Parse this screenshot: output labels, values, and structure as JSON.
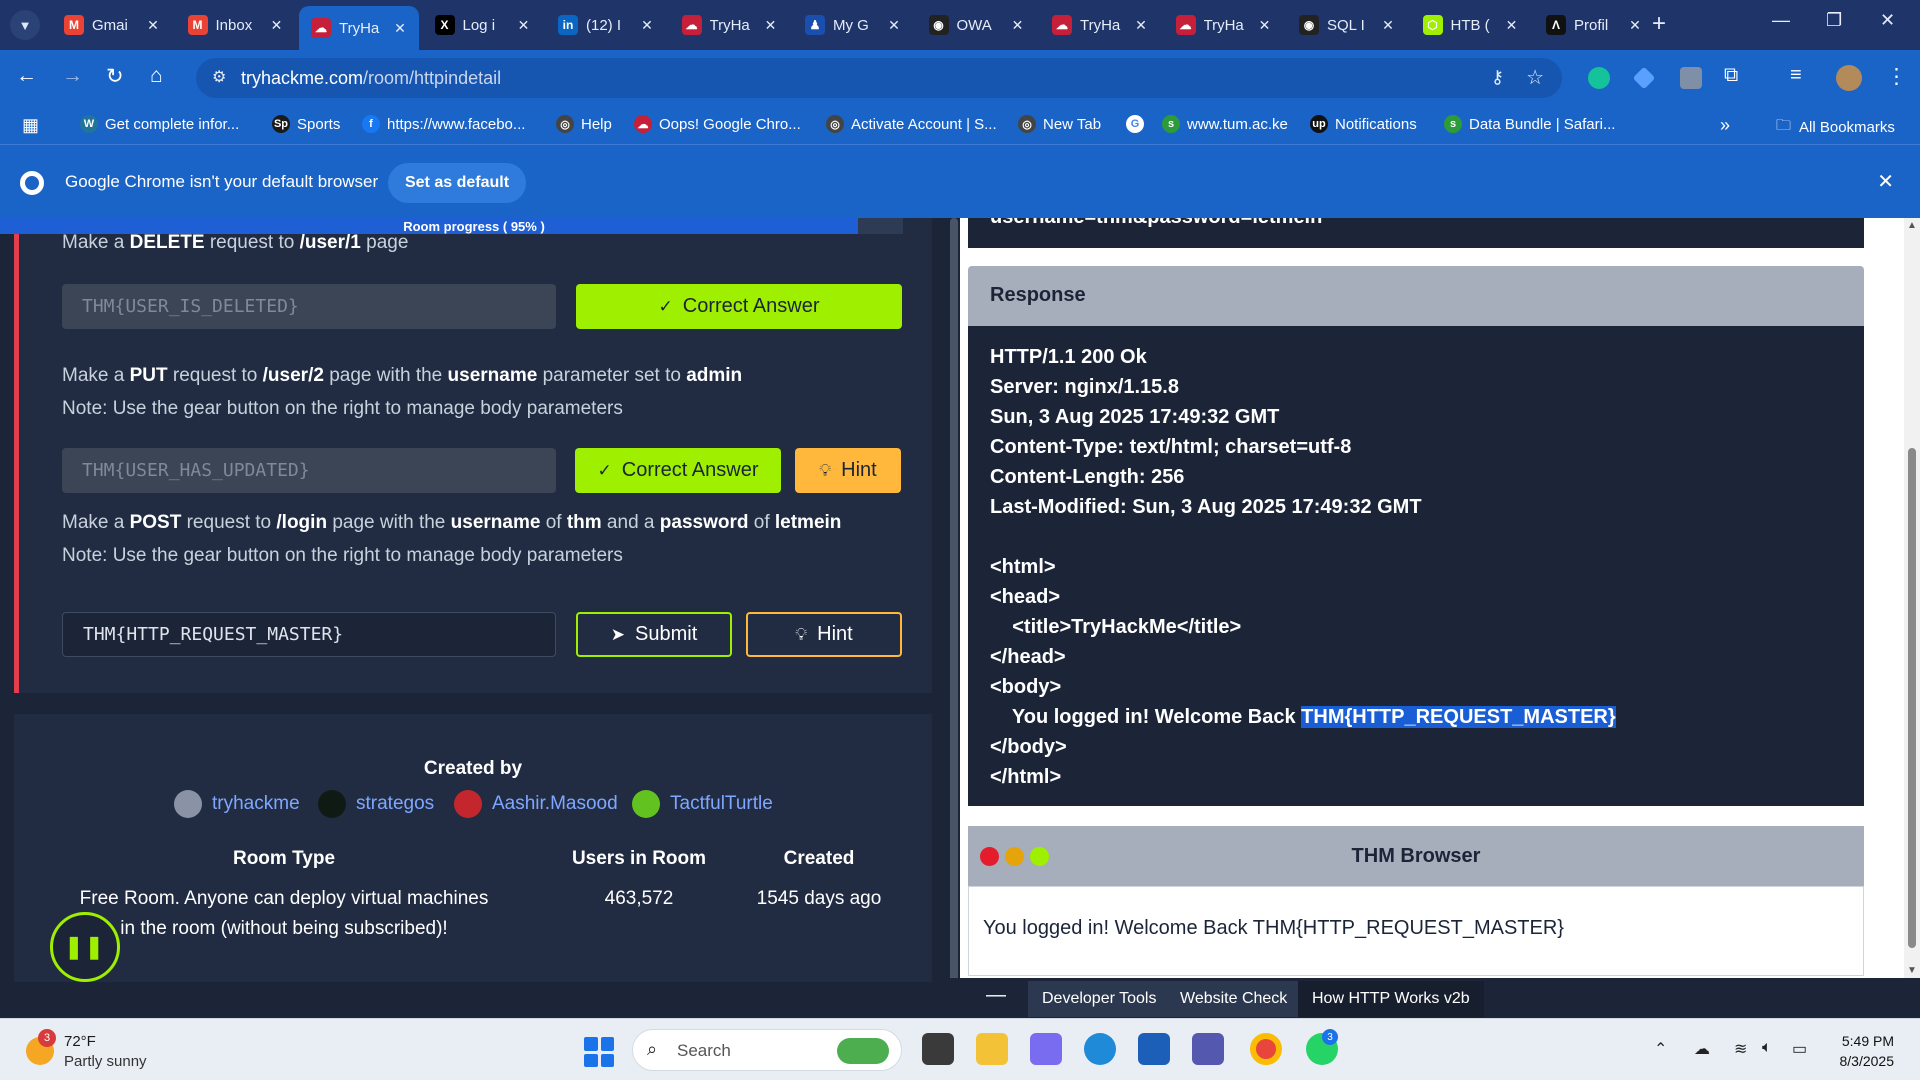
{
  "browser": {
    "tabs": [
      {
        "title": "Gmai",
        "icon": "gmail-icon",
        "color": "#ea4335",
        "glyph": "M"
      },
      {
        "title": "Inbox",
        "icon": "gmail-icon",
        "color": "#ea4335",
        "glyph": "M"
      },
      {
        "title": "TryHa",
        "icon": "tryhackme-icon",
        "color": "#c51f3a",
        "glyph": "☁",
        "active": true
      },
      {
        "title": "Log i",
        "icon": "x-icon",
        "color": "#000000",
        "glyph": "X"
      },
      {
        "title": "(12) I",
        "icon": "linkedin-icon",
        "color": "#0a66c2",
        "glyph": "in"
      },
      {
        "title": "TryHa",
        "icon": "tryhackme-icon",
        "color": "#c51f3a",
        "glyph": "☁"
      },
      {
        "title": "My G",
        "icon": "mygov-icon",
        "color": "#1a4fb0",
        "glyph": "♟"
      },
      {
        "title": "OWA",
        "icon": "owasp-icon",
        "color": "#222222",
        "glyph": "◉"
      },
      {
        "title": "TryHa",
        "icon": "tryhackme-icon",
        "color": "#c51f3a",
        "glyph": "☁"
      },
      {
        "title": "TryHa",
        "icon": "tryhackme-icon",
        "color": "#c51f3a",
        "glyph": "☁"
      },
      {
        "title": "SQL I",
        "icon": "portswigger-icon",
        "color": "#222222",
        "glyph": "◉"
      },
      {
        "title": "HTB (",
        "icon": "hackthebox-icon",
        "color": "#9fef00",
        "glyph": "⬡"
      },
      {
        "title": "Profil",
        "icon": "profile-icon",
        "color": "#111111",
        "glyph": "Λ"
      }
    ],
    "url_host": "tryhackme.com",
    "url_path": "/room/httpindetail"
  },
  "bookmarks": [
    {
      "label": "Get complete infor...",
      "color": "#21759b",
      "glyph": "W"
    },
    {
      "label": "Sports",
      "color": "#1a1a1a",
      "glyph": "Sp"
    },
    {
      "label": "https://www.facebo...",
      "color": "#1877f2",
      "glyph": "f"
    },
    {
      "label": "Help",
      "color": "#444444",
      "glyph": "◎"
    },
    {
      "label": "Oops! Google Chro...",
      "color": "#c51f3a",
      "glyph": "☁"
    },
    {
      "label": "Activate Account | S...",
      "color": "#444444",
      "glyph": "◎"
    },
    {
      "label": "New Tab",
      "color": "#444444",
      "glyph": "◎"
    },
    {
      "label": "",
      "color": "#ffffff",
      "glyph": "G"
    },
    {
      "label": "www.tum.ac.ke",
      "color": "#2e9b3a",
      "glyph": "s"
    },
    {
      "label": "Notifications",
      "color": "#111111",
      "glyph": "up"
    },
    {
      "label": "Data Bundle | Safari...",
      "color": "#2e9b3a",
      "glyph": "s"
    }
  ],
  "all_bookmarks": "All Bookmarks",
  "infobar": {
    "message": "Google Chrome isn't your default browser",
    "button": "Set as default"
  },
  "room": {
    "progress_label": "Room progress ( 95% )",
    "progress_value": 0.95,
    "q1": {
      "pre": "Make a ",
      "b1": "DELETE",
      "mid": " request to ",
      "b2": "/user/1",
      "post": " page"
    },
    "q1_answer": "THM{USER_IS_DELETED}",
    "correct_label": "Correct Answer",
    "q2": {
      "pre": "Make a ",
      "b1": "PUT",
      "mid1": " request to ",
      "b2": "/user/2",
      "mid2": " page with the ",
      "b3": "username",
      "mid3": " parameter set to ",
      "b4": "admin"
    },
    "note": "Note: Use the gear button on the right to manage body parameters",
    "q2_answer": "THM{USER_HAS_UPDATED}",
    "hint_label": "Hint",
    "q3": {
      "pre": "Make a ",
      "b1": "POST",
      "mid1": " request to ",
      "b2": "/login",
      "mid2": " page with the ",
      "b3": "username",
      "mid3": " of ",
      "b4": "thm",
      "mid4": " and a ",
      "b5": "password",
      "mid5": " of ",
      "b6": "letmein"
    },
    "q3_answer": "THM{HTTP_REQUEST_MASTER}",
    "submit_label": "Submit"
  },
  "creators": {
    "heading": "Created by",
    "authors": [
      {
        "name": "tryhackme",
        "color": "#8a93a6"
      },
      {
        "name": "strategos",
        "color": "#0f1a14"
      },
      {
        "name": "Aashir.Masood",
        "color": "#c4262e"
      },
      {
        "name": "TactfulTurtle",
        "color": "#62c21f"
      }
    ],
    "room_type_h": "Room Type",
    "room_type_v1": "Free Room. Anyone can deploy virtual machines",
    "room_type_v2": "in the room (without being subscribed)!",
    "users_h": "Users in Room",
    "users_v": "463,572",
    "created_h": "Created",
    "created_v": "1545 days ago",
    "pause_glyph": "❚❚"
  },
  "site": {
    "request_tail": "username=thm&password=letmein",
    "response_title": "Response",
    "response_lines": [
      "HTTP/1.1 200 Ok",
      "Server: nginx/1.15.8",
      "Sun, 3 Aug 2025 17:49:32 GMT",
      "Content-Type: text/html; charset=utf-8",
      "Content-Length: 256",
      "Last-Modified: Sun, 3 Aug 2025 17:49:32 GMT",
      "",
      "<html>",
      "<head>",
      "    <title>TryHackMe</title>",
      "</head>",
      "<body>"
    ],
    "welcome_prefix": "    You logged in! Welcome Back ",
    "welcome_flag": "THM{HTTP_REQUEST_MASTER}",
    "response_tail": [
      "</body>",
      "</html>"
    ],
    "browser_title": "THM Browser",
    "browser_body": "You logged in! Welcome Back THM{HTTP_REQUEST_MASTER}",
    "bottom_tabs": [
      "Developer Tools",
      "Website Check",
      "How HTTP Works v2b"
    ]
  },
  "taskbar": {
    "temp": "72°F",
    "weather": "Partly sunny",
    "weather_badge": "3",
    "search": "Search",
    "whatsapp_badge": "3",
    "time": "5:49 PM",
    "date": "8/3/2025"
  },
  "colors": {
    "accent_green": "#9fef00",
    "hint_orange": "#ffb83b",
    "task_border": "#e33d4e",
    "chrome_blue": "#1a64c8"
  }
}
